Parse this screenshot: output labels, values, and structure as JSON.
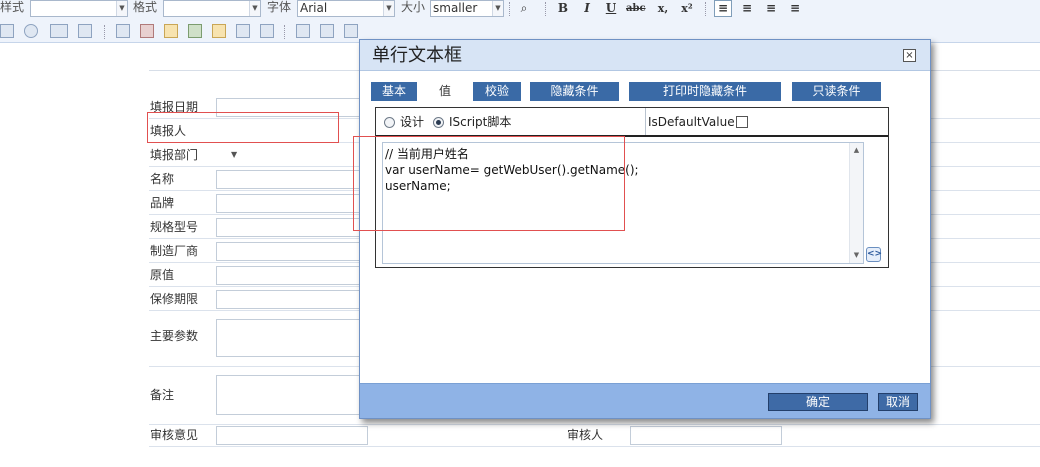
{
  "toolbar": {
    "style_label": "样式",
    "format_label": "格式",
    "font_label": "字体",
    "font_value": "Arial",
    "size_label": "大小",
    "size_value": "smaller",
    "bold": "B",
    "italic": "I",
    "underline": "U",
    "strike": "abc",
    "subscript": "x,",
    "superscript": "x²"
  },
  "form": {
    "rows": [
      {
        "label": "填报日期"
      },
      {
        "label": "填报人"
      },
      {
        "label": "填报部门"
      },
      {
        "label": "名称"
      },
      {
        "label": "品牌"
      },
      {
        "label": "规格型号"
      },
      {
        "label": "制造厂商"
      },
      {
        "label": "原值"
      },
      {
        "label": "保修期限"
      },
      {
        "label": "主要参数"
      },
      {
        "label": "备注"
      },
      {
        "label": "审核意见"
      }
    ],
    "reviewer_label": "审核人"
  },
  "dialog": {
    "title": "单行文本框",
    "close": "×",
    "tabs": [
      {
        "label": "基本"
      },
      {
        "label": "值"
      },
      {
        "label": "校验"
      },
      {
        "label": "隐藏条件"
      },
      {
        "label": "打印时隐藏条件"
      },
      {
        "label": "只读条件"
      }
    ],
    "mode_design": "设计",
    "mode_script": "IScript脚本",
    "is_default_label": "IsDefaultValue:",
    "code_lines": [
      "// 当前用户姓名",
      "var userName= getWebUser().getName();",
      "userName;"
    ],
    "ok": "确定",
    "cancel": "取消"
  },
  "colors": {
    "accent": "#3a6aa6",
    "footer": "#8fb3e6",
    "highlight": "#e15050"
  }
}
